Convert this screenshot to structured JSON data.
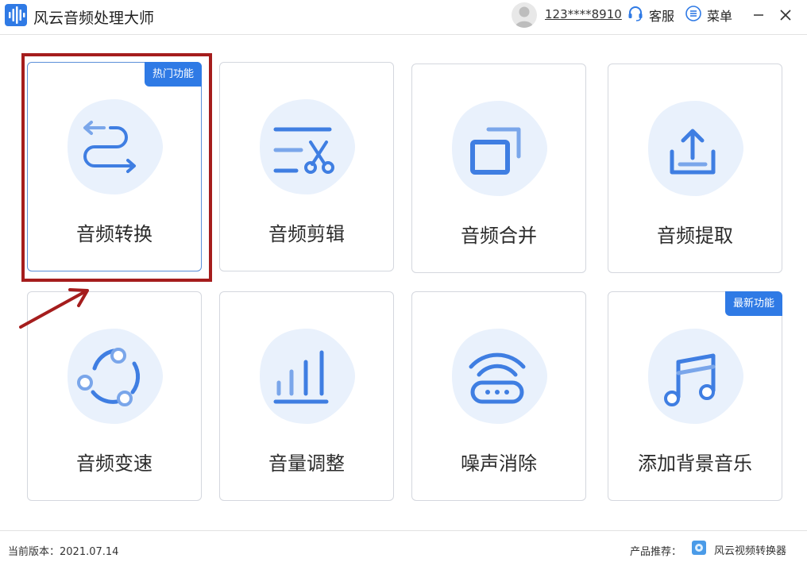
{
  "app": {
    "title": "风云音频处理大师"
  },
  "header": {
    "username": "123****8910",
    "service_label": "客服",
    "menu_label": "菜单"
  },
  "cards": [
    {
      "label": "音频转换",
      "badge": "热门功能",
      "icon": "convert-arrows-icon"
    },
    {
      "label": "音频剪辑",
      "icon": "scissors-icon"
    },
    {
      "label": "音频合并",
      "icon": "merge-windows-icon"
    },
    {
      "label": "音频提取",
      "icon": "upload-extract-icon"
    },
    {
      "label": "音频变速",
      "icon": "cycle-dots-icon"
    },
    {
      "label": "音量调整",
      "icon": "volume-bars-icon"
    },
    {
      "label": "噪声消除",
      "icon": "noise-signal-icon"
    },
    {
      "label": "添加背景音乐",
      "badge": "最新功能",
      "icon": "music-note-icon"
    }
  ],
  "footer": {
    "version": "当前版本：2021.07.14",
    "recommend_label": "产品推荐：",
    "product_name": "风云视频转换器"
  },
  "colors": {
    "accent": "#2f7ae5",
    "icon": "#3f7ee2",
    "blob": "#e9f1fc",
    "highlight": "#a51d1d"
  }
}
